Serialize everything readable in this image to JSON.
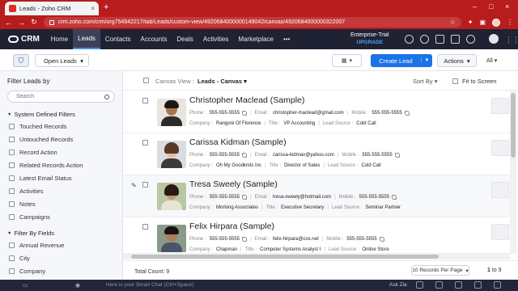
{
  "browser": {
    "tab_title": "Leads - Zoho CRM",
    "url": "crm.zoho.com/crm/org754942217/tab/Leads/custom-view/4920684000000149042/canvas/4920684000000322007",
    "new_tab": "+",
    "tab_close": "×",
    "window_controls": [
      "–",
      "□",
      "×"
    ],
    "nav_back": "←",
    "nav_forward": "→",
    "nav_reload": "↻"
  },
  "crm_nav": {
    "logo": "CRM",
    "items": [
      "Home",
      "Leads",
      "Contacts",
      "Accounts",
      "Deals",
      "Activities",
      "Marketplace"
    ],
    "active": "Leads",
    "more": "•••",
    "trial_line1": "Enterprise-Trial",
    "trial_line2": "UPGRADE"
  },
  "toolbar": {
    "view_selector": "Open Leads",
    "view_icon_caret": "▾",
    "create_label": "Create Lead",
    "actions_label": "Actions",
    "all_label": "All"
  },
  "sidebar": {
    "title": "Filter Leads by",
    "search_placeholder": "Search",
    "system_section": "System Defined Filters",
    "system_filters": [
      "Touched Records",
      "Untouched Records",
      "Record Action",
      "Related Records Action",
      "Latest Email Status",
      "Activities",
      "Notes",
      "Campaigns"
    ],
    "field_section": "Filter By Fields",
    "field_filters": [
      "Annual Revenue",
      "City",
      "Company"
    ]
  },
  "main": {
    "canvas_view_label": "Canvas View :",
    "canvas_view_value": "Leads - Canvas",
    "sort_by": "Sort By",
    "fit_to_screen": "Fit to Screen",
    "labels": {
      "phone": "Phone :",
      "email": "Email :",
      "mobile": "Mobile :",
      "company": "Company :",
      "title": "Title :",
      "lead_source": "Lead Source :"
    },
    "records": [
      {
        "name": "Christopher Maclead (Sample)",
        "phone": "555-555-5555",
        "email": "christopher-maclead@gmail.com",
        "mobile": "555-555-5555",
        "company": "Rangoni Of Florence",
        "title": "VP Accounting",
        "lead_source": "Cold Call"
      },
      {
        "name": "Carissa Kidman (Sample)",
        "phone": "555-555-5555",
        "email": "carissa-kidman@yahoo.com",
        "mobile": "555-555-5555",
        "company": "Oh My Goodknits Inc",
        "title": "Director of Sales",
        "lead_source": "Cold Call"
      },
      {
        "name": "Tresa Sweely (Sample)",
        "phone": "555-555-5555",
        "email": "tresa-sweely@hotmail.com",
        "mobile": "555-555-5555",
        "company": "Morlong Associates",
        "title": "Executive Secretary",
        "lead_source": "Seminar Partner"
      },
      {
        "name": "Felix Hirpara (Sample)",
        "phone": "555-555-5555",
        "email": "felix-hirpara@cox.net",
        "mobile": "555-555-5555",
        "company": "Chapman",
        "title": "Computer Systems Analyst I",
        "lead_source": "Online Store"
      }
    ],
    "total_count": "Total Count: 9",
    "per_page": "10 Records Per Page",
    "page_current": "1",
    "page_total": "to 9"
  },
  "bottom_bar": {
    "smart_chat": "Here is your Smart Chat (Ctrl+Space)",
    "ask_zia": "Ask Zia"
  },
  "colors": {
    "brand_red": "#b91c1c",
    "nav_dark": "#1f2233",
    "primary_blue": "#1a73e8"
  }
}
